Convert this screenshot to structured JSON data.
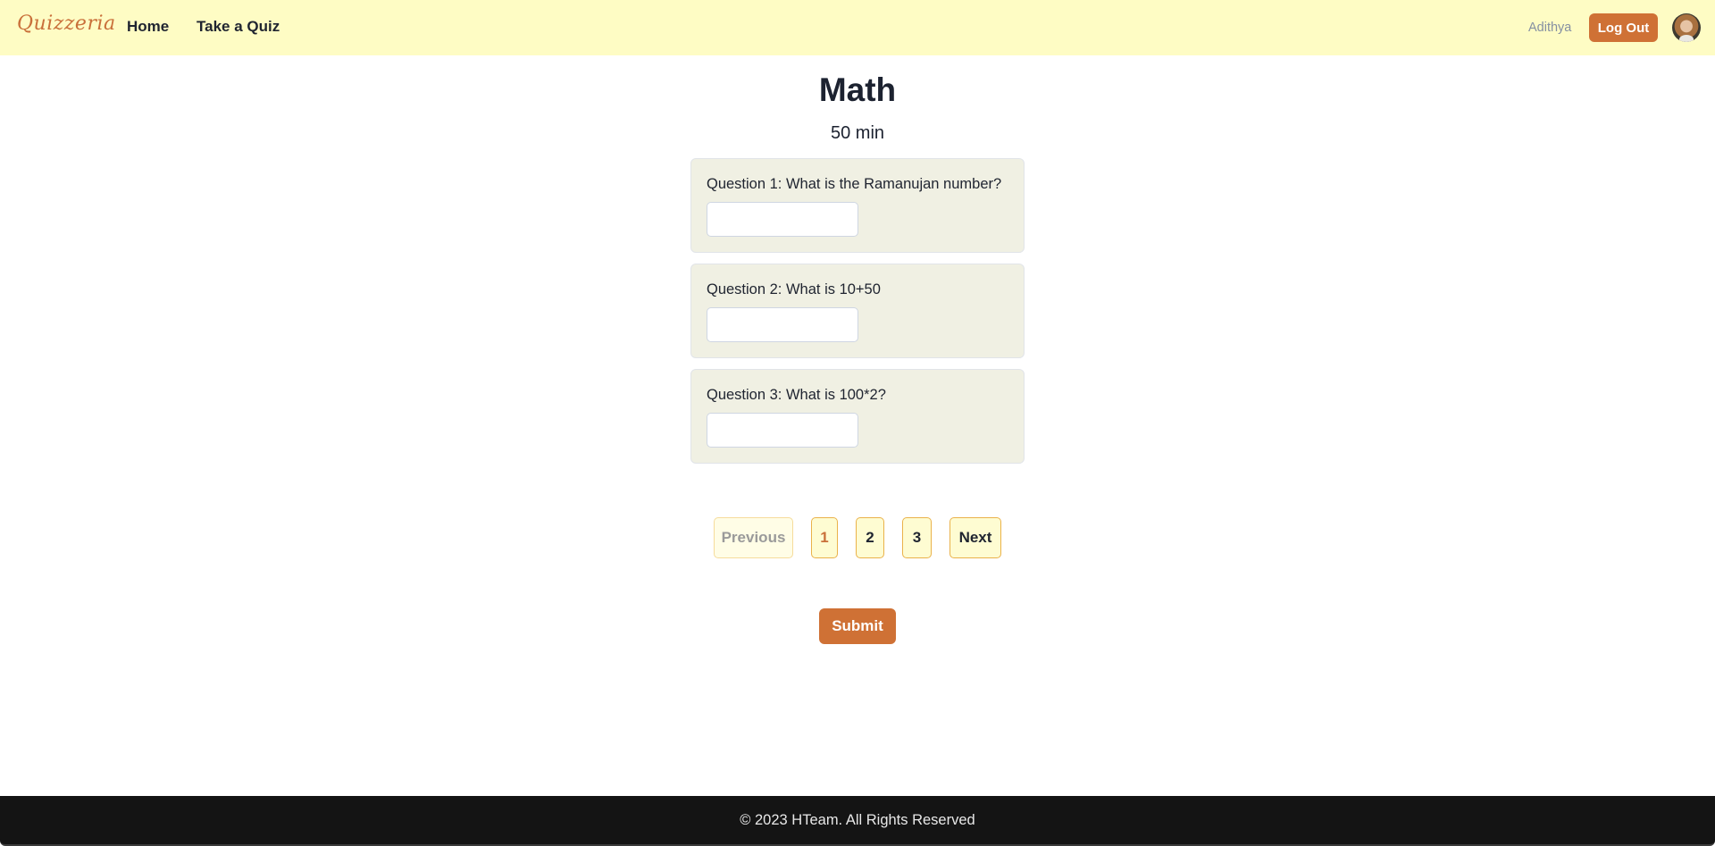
{
  "navbar": {
    "brand": "Quizzeria",
    "links": [
      {
        "label": "Home"
      },
      {
        "label": "Take a Quiz"
      }
    ],
    "username": "Adithya",
    "logout_label": "Log Out",
    "avatar_icon": "user-avatar"
  },
  "quiz": {
    "title": "Math",
    "duration": "50 min",
    "questions": [
      {
        "label": "Question 1: What is the Ramanujan number?",
        "value": "",
        "placeholder": ""
      },
      {
        "label": "Question 2: What is 10+50",
        "value": "",
        "placeholder": ""
      },
      {
        "label": "Question 3: What is 100*2?",
        "value": "",
        "placeholder": ""
      }
    ]
  },
  "pagination": {
    "previous_label": "Previous",
    "pages": [
      "1",
      "2",
      "3"
    ],
    "current_page": "1",
    "next_label": "Next"
  },
  "submit_label": "Submit",
  "footer": {
    "text": "© 2023 HTeam. All Rights Reserved"
  },
  "colors": {
    "navbar_bg": "#fefcc4",
    "accent": "#cf7135",
    "card_bg": "#f0f0e3",
    "pagination_border": "#eab24a",
    "footer_bg": "#141414"
  }
}
